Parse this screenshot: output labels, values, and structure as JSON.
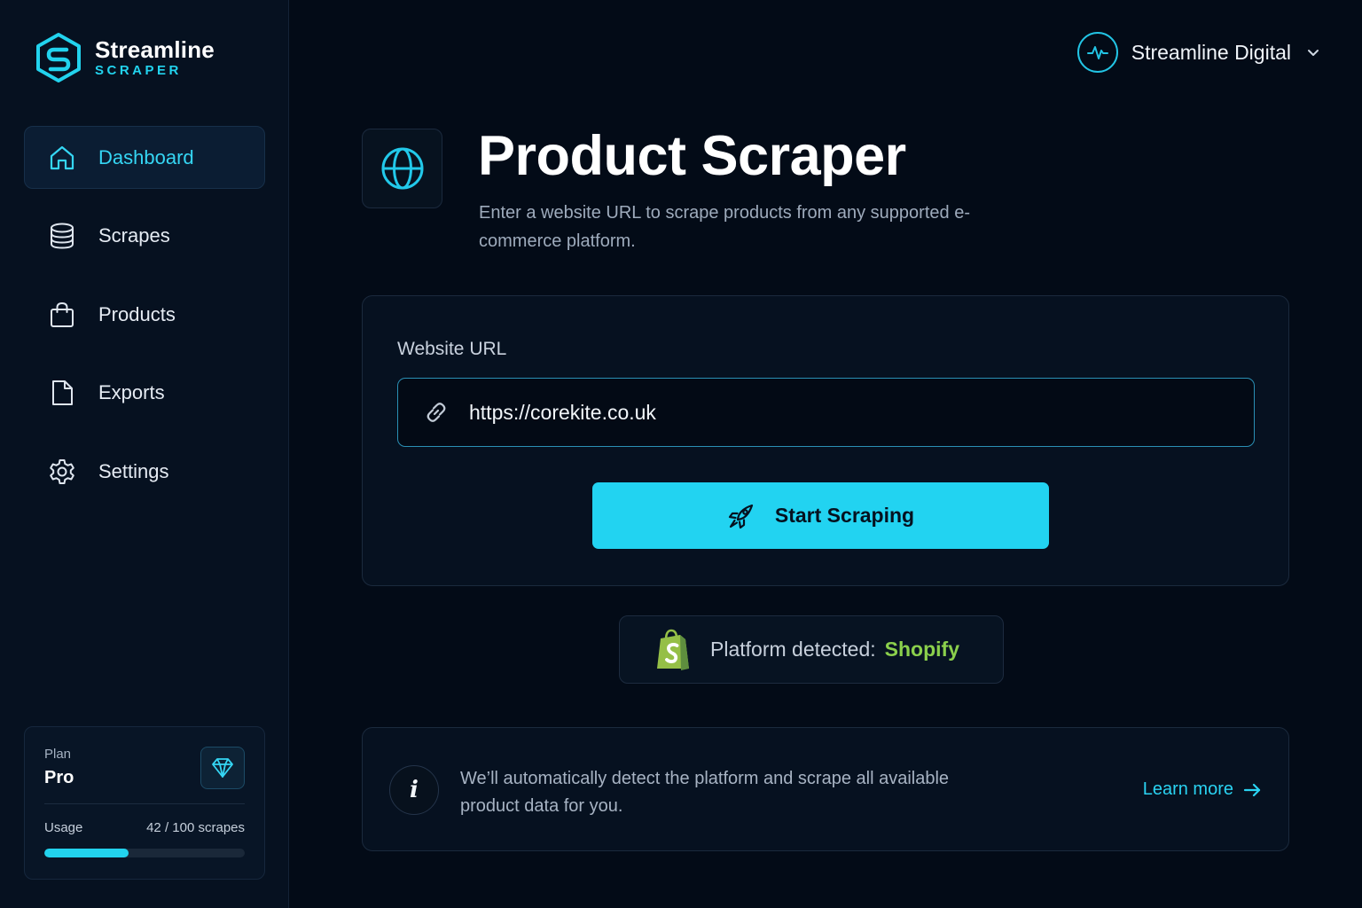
{
  "brand": {
    "name": "Streamline",
    "sub": "SCRAPER"
  },
  "nav": [
    {
      "label": "Dashboard",
      "icon": "home-icon",
      "active": true
    },
    {
      "label": "Scrapes",
      "icon": "database-icon",
      "active": false
    },
    {
      "label": "Products",
      "icon": "shopping-bag-icon",
      "active": false
    },
    {
      "label": "Exports",
      "icon": "file-icon",
      "active": false
    },
    {
      "label": "Settings",
      "icon": "gear-icon",
      "active": false
    }
  ],
  "plan": {
    "label": "Plan",
    "value": "Pro",
    "icon": "diamond-icon",
    "usage_label": "Usage",
    "usage_count": "42 / 100 scrapes",
    "usage_fraction": 0.42
  },
  "account": {
    "name": "Streamline Digital",
    "icon": "activity-pulse-icon"
  },
  "page": {
    "title": "Product Scraper",
    "description": "Enter a website URL to scrape products from any supported e-commerce platform.",
    "icon": "globe-icon"
  },
  "form": {
    "label": "Website URL",
    "url_value": "https://corekite.co.uk",
    "button_label": "Start Scraping",
    "button_icon": "rocket-icon"
  },
  "platform": {
    "prefix": "Platform detected:",
    "name": "Shopify",
    "icon": "shopify-bag-icon"
  },
  "info": {
    "icon": "info-icon",
    "icon_glyph": "i",
    "text": "We’ll automatically detect the platform and scrape all available product data for you.",
    "link_label": "Learn more"
  },
  "colors": {
    "accent": "#22d3ee",
    "background": "#030b17",
    "sidebar": "#061120",
    "shopify_green": "#8bd04c"
  }
}
